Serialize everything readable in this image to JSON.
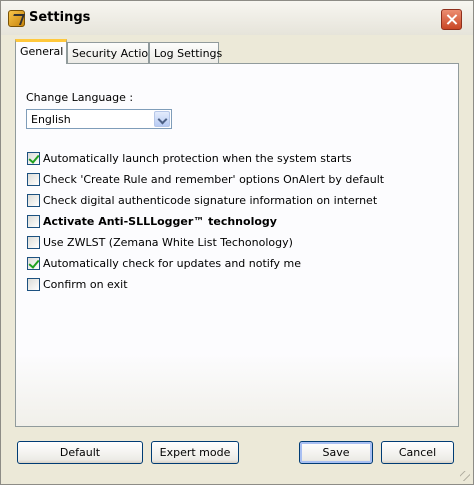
{
  "window": {
    "title": "Settings"
  },
  "tabs": [
    {
      "label": "General",
      "active": true
    },
    {
      "label": "Security Action",
      "active": false
    },
    {
      "label": "Log Settings",
      "active": false
    }
  ],
  "general": {
    "language_label": "Change Language :",
    "language_selected": "English",
    "options": [
      {
        "label": "Automatically launch protection when the system starts",
        "checked": true
      },
      {
        "label": "Check 'Create Rule and remember' options OnAlert by default",
        "checked": false
      },
      {
        "label": "Check digital authenticode signature information on internet",
        "checked": false
      },
      {
        "label": "Activate Anti-SLLLogger™ technology",
        "checked": false
      },
      {
        "label": "Use ZWLST (Zemana White List Techonology)",
        "checked": false
      },
      {
        "label": "Automatically check for updates and notify me",
        "checked": true
      },
      {
        "label": "Confirm on exit",
        "checked": false
      }
    ]
  },
  "buttons": {
    "default": "Default",
    "expert": "Expert mode",
    "save": "Save",
    "cancel": "Cancel"
  }
}
